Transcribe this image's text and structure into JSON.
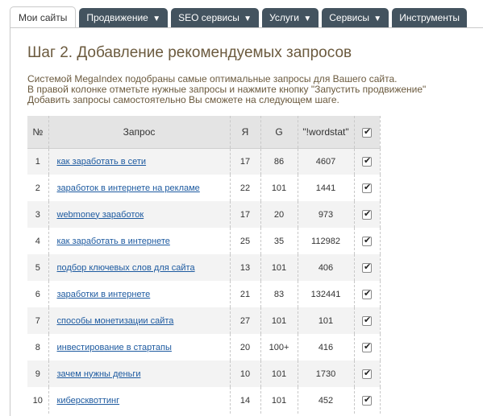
{
  "tabs": [
    {
      "label": "Мои сайты",
      "arrow": ""
    },
    {
      "label": "Продвижение",
      "arrow": "▼"
    },
    {
      "label": "SEO сервисы",
      "arrow": "▼"
    },
    {
      "label": "Услуги",
      "arrow": "▼"
    },
    {
      "label": "Сервисы",
      "arrow": "▼"
    },
    {
      "label": "Инструменты",
      "arrow": ""
    }
  ],
  "page": {
    "title": "Шаг 2. Добавление рекомендуемых запросов",
    "intro": [
      "Системой MegaIndex подобраны самые оптимальные запросы для Вашего сайта.",
      "В правой колонке отметьте нужные запросы и нажмите кнопку \"Запустить продвижение\"",
      "Добавить запросы самостоятельно Вы сможете на следующем шаге."
    ]
  },
  "table": {
    "headers": {
      "num": "№",
      "query": "Запрос",
      "y": "Я",
      "g": "G",
      "wordstat": "\"!wordstat\""
    },
    "rows": [
      {
        "num": "1",
        "query": "как заработать в сети",
        "y": "17",
        "g": "86",
        "wordstat": "4607",
        "checked": true
      },
      {
        "num": "2",
        "query": "заработок в интернете на рекламе",
        "y": "22",
        "g": "101",
        "wordstat": "1441",
        "checked": true
      },
      {
        "num": "3",
        "query": "webmoney заработок",
        "y": "17",
        "g": "20",
        "wordstat": "973",
        "checked": true
      },
      {
        "num": "4",
        "query": "как заработать в интернете",
        "y": "25",
        "g": "35",
        "wordstat": "112982",
        "checked": true
      },
      {
        "num": "5",
        "query": "подбор ключевых слов для сайта",
        "y": "13",
        "g": "101",
        "wordstat": "406",
        "checked": true
      },
      {
        "num": "6",
        "query": "заработки в интернете",
        "y": "21",
        "g": "83",
        "wordstat": "132441",
        "checked": true
      },
      {
        "num": "7",
        "query": "способы монетизации сайта",
        "y": "27",
        "g": "101",
        "wordstat": "101",
        "checked": true
      },
      {
        "num": "8",
        "query": "инвестирование в стартапы",
        "y": "20",
        "g": "100+",
        "wordstat": "416",
        "checked": true
      },
      {
        "num": "9",
        "query": "зачем нужны деньги",
        "y": "10",
        "g": "101",
        "wordstat": "1730",
        "checked": true
      },
      {
        "num": "10",
        "query": "киберсквоттинг",
        "y": "14",
        "g": "101",
        "wordstat": "452",
        "checked": true
      }
    ]
  }
}
